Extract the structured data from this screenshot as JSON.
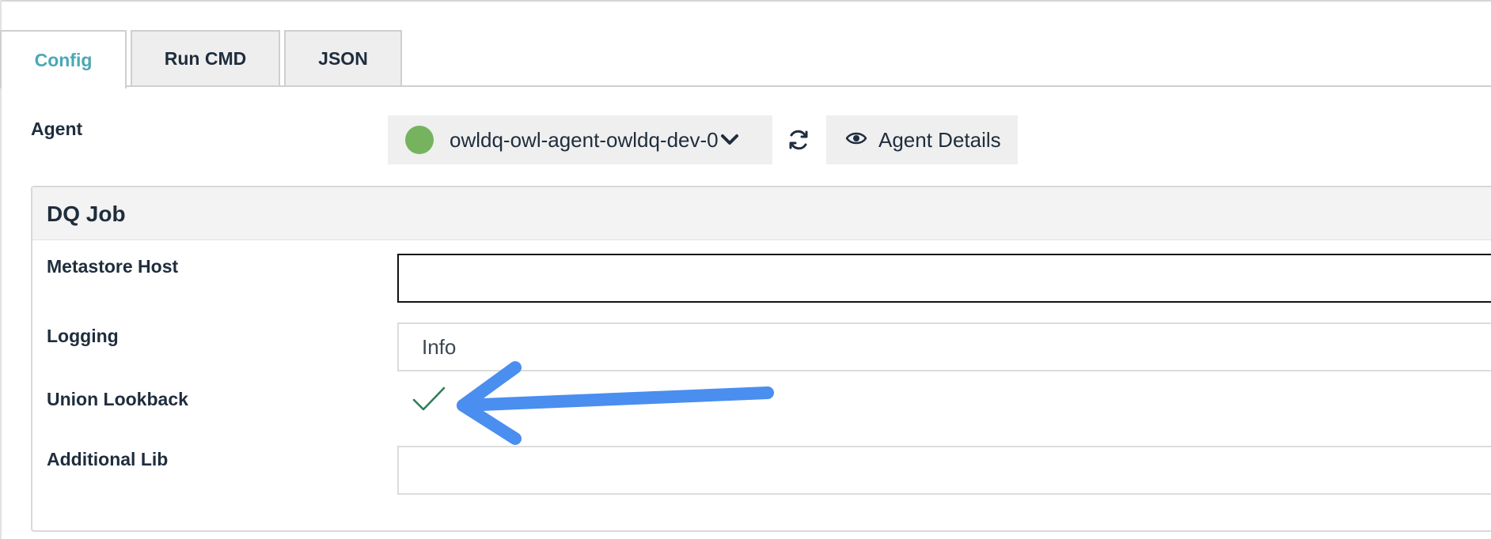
{
  "tabs": [
    {
      "label": "Config",
      "active": true
    },
    {
      "label": "Run CMD",
      "active": false
    },
    {
      "label": "JSON",
      "active": false
    }
  ],
  "agent": {
    "label": "Agent",
    "status_color": "#76b35f",
    "selected": "owldq-owl-agent-owldq-dev-0",
    "refresh_icon": "refresh-icon",
    "details_label": "Agent Details",
    "details_icon": "eye-icon"
  },
  "panel": {
    "title": "DQ Job",
    "fields": {
      "metastore_host": {
        "label": "Metastore Host",
        "value": ""
      },
      "logging": {
        "label": "Logging",
        "value": "Info"
      },
      "union_lookback": {
        "label": "Union Lookback",
        "checked": true
      },
      "additional_lib": {
        "label": "Additional Lib",
        "value": ""
      }
    }
  },
  "colors": {
    "accent": "#4aa8b5",
    "annotation": "#4a8ef0",
    "check": "#2e7d55"
  }
}
